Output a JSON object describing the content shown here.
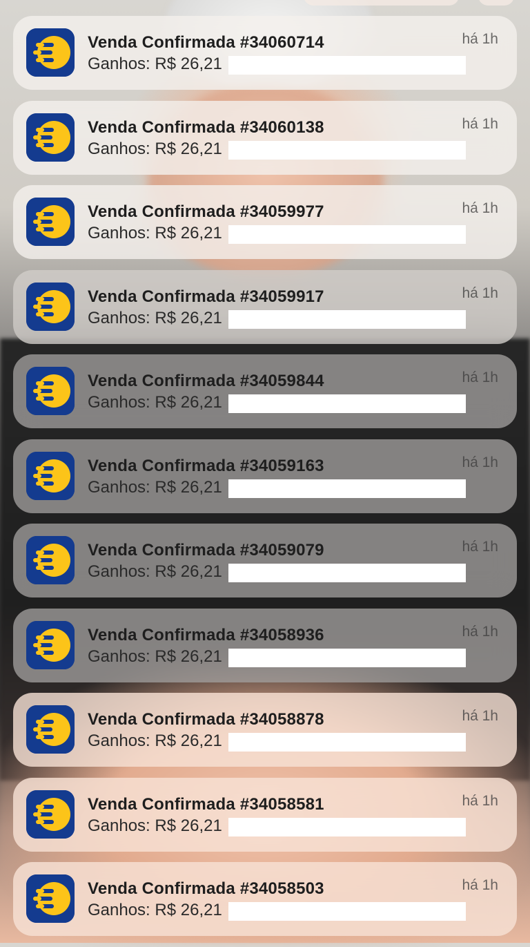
{
  "notifications": [
    {
      "title": "Venda Confirmada #34060714",
      "body": "Ganhos: R$ 26,21",
      "time": "há 1h",
      "icon": "eduzz-logo-icon",
      "tone": "light"
    },
    {
      "title": "Venda Confirmada #34060138",
      "body": "Ganhos: R$ 26,21",
      "time": "há 1h",
      "icon": "eduzz-logo-icon",
      "tone": "light"
    },
    {
      "title": "Venda Confirmada #34059977",
      "body": "Ganhos: R$ 26,21",
      "time": "há 1h",
      "icon": "eduzz-logo-icon",
      "tone": "light"
    },
    {
      "title": "Venda Confirmada #34059917",
      "body": "Ganhos: R$ 26,21",
      "time": "há 1h",
      "icon": "eduzz-logo-icon",
      "tone": "mid"
    },
    {
      "title": "Venda Confirmada #34059844",
      "body": "Ganhos: R$ 26,21",
      "time": "há 1h",
      "icon": "eduzz-logo-icon",
      "tone": "dark"
    },
    {
      "title": "Venda Confirmada #34059163",
      "body": "Ganhos: R$ 26,21",
      "time": "há 1h",
      "icon": "eduzz-logo-icon",
      "tone": "dark"
    },
    {
      "title": "Venda Confirmada #34059079",
      "body": "Ganhos: R$ 26,21",
      "time": "há 1h",
      "icon": "eduzz-logo-icon",
      "tone": "dark"
    },
    {
      "title": "Venda Confirmada #34058936",
      "body": "Ganhos: R$ 26,21",
      "time": "há 1h",
      "icon": "eduzz-logo-icon",
      "tone": "dark"
    },
    {
      "title": "Venda Confirmada #34058878",
      "body": "Ganhos: R$ 26,21",
      "time": "há 1h",
      "icon": "eduzz-logo-icon",
      "tone": "warm"
    },
    {
      "title": "Venda Confirmada #34058581",
      "body": "Ganhos: R$ 26,21",
      "time": "há 1h",
      "icon": "eduzz-logo-icon",
      "tone": "warm"
    },
    {
      "title": "Venda Confirmada #34058503",
      "body": "Ganhos: R$ 26,21",
      "time": "há 1h",
      "icon": "eduzz-logo-icon",
      "tone": "warm"
    }
  ],
  "colors": {
    "icon_background": "#143b8f",
    "icon_accent": "#fcc419",
    "redaction": "#ffffff"
  }
}
